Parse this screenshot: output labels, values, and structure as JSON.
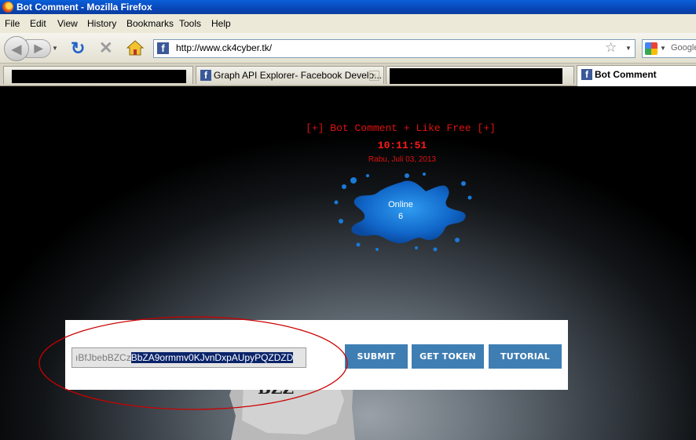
{
  "window": {
    "title": "Bot Comment - Mozilla Firefox"
  },
  "menu": [
    "File",
    "Edit",
    "View",
    "History",
    "Bookmarks",
    "Tools",
    "Help"
  ],
  "navbar": {
    "url": "http://www.ck4cyber.tk/",
    "search_placeholder": "Google"
  },
  "tabs": [
    {
      "label": "",
      "redacted": true
    },
    {
      "label": "Graph API Explorer- Facebook Develo...",
      "icon": "facebook-icon"
    },
    {
      "label": "",
      "redacted": true
    },
    {
      "label": "Bot Comment",
      "icon": "facebook-icon",
      "active": true
    }
  ],
  "page": {
    "heading": "[+] Bot Comment + Like Free [+]",
    "clock": "10:11:51",
    "date": "Rabu, Juli 03, 2013",
    "online_label": "Online",
    "online_count": "6",
    "token_unselected": "ıBfJbebBZCz",
    "token_selected": "BbZA9ormmv0KJvnDxpAUpyPQZDZD",
    "buttons": {
      "submit": "SUBMIT",
      "get_token": "GET TOKEN",
      "tutorial": "TUTORIAL"
    }
  },
  "colors": {
    "accent_button": "#3f7eb3",
    "heading_red": "#e01010",
    "selection": "#0a246a",
    "annotation": "#cc0000"
  }
}
